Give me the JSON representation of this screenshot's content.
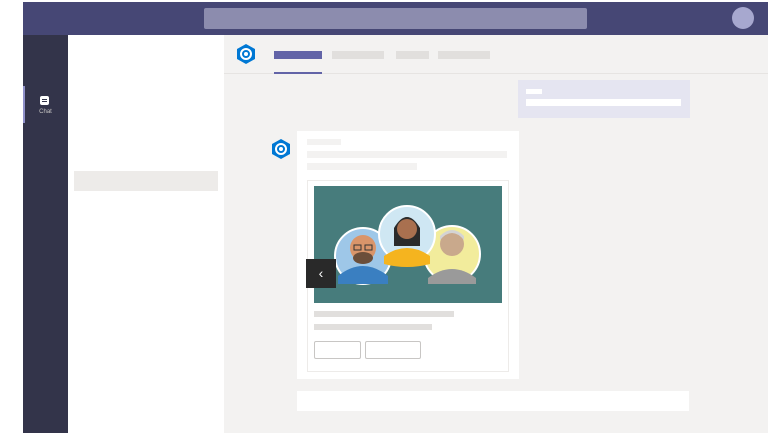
{
  "rail": {
    "items": [
      {
        "label": "Chat",
        "icon": "chat-icon"
      }
    ]
  },
  "header": {
    "app_icon": "bot-hexagon-icon"
  },
  "card": {
    "carousel_prev_glyph": "‹",
    "hero_image": "people-avatars-illustration"
  },
  "colors": {
    "brand": "#464775",
    "accent": "#6264a7",
    "app_icon_blue": "#0078d4",
    "hero_background": "#477c7c"
  }
}
